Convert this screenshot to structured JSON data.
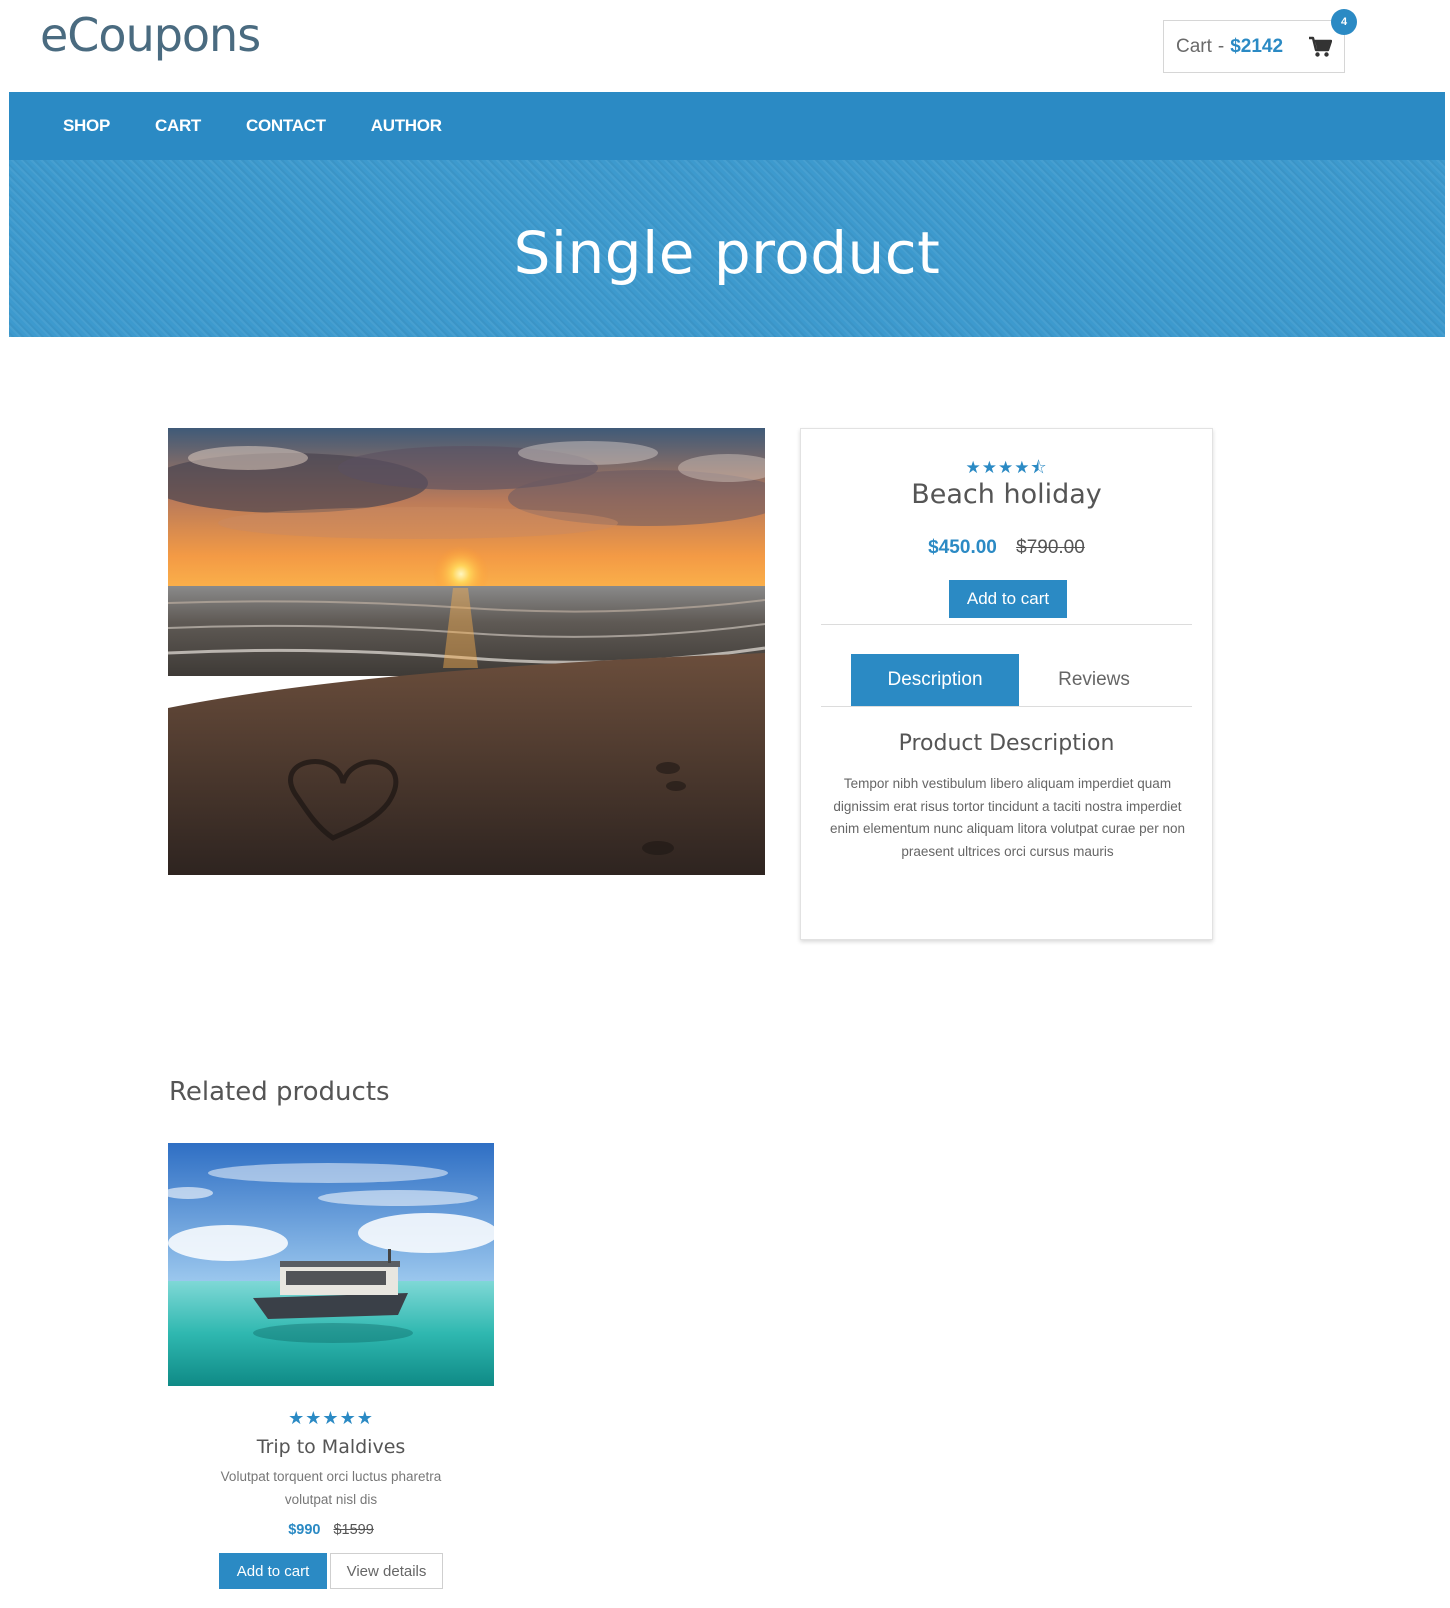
{
  "header": {
    "logo": "eCoupons",
    "cart_label": "Cart",
    "cart_separator": "-",
    "cart_amount": "$2142",
    "cart_count": "4"
  },
  "nav": {
    "items": [
      {
        "label": "SHOP"
      },
      {
        "label": "CART"
      },
      {
        "label": "CONTACT"
      },
      {
        "label": "AUTHOR"
      }
    ]
  },
  "hero": {
    "title": "Single product"
  },
  "product": {
    "rating": 4.5,
    "rating_stars": "★★★★⯪",
    "name": "Beach holiday",
    "price": "$450.00",
    "old_price": "$790.00",
    "add_to_cart_label": "Add to cart",
    "tabs": [
      {
        "label": "Description",
        "active": true
      },
      {
        "label": "Reviews",
        "active": false
      }
    ],
    "description_title": "Product Description",
    "description_text": "Tempor nibh vestibulum libero aliquam imperdiet quam dignissim erat risus tortor tincidunt a taciti nostra imperdiet enim elementum nunc aliquam litora volutpat curae per non praesent ultrices orci cursus mauris"
  },
  "related": {
    "title": "Related products",
    "items": [
      {
        "rating": 5,
        "rating_stars": "★★★★★",
        "name": "Trip to Maldives",
        "description": "Volutpat torquent orci luctus pharetra volutpat nisl dis",
        "price": "$990",
        "old_price": "$1599",
        "add_to_cart_label": "Add to cart",
        "view_details_label": "View details"
      }
    ]
  },
  "colors": {
    "accent": "#2b8ac4",
    "hero": "#3d9ace"
  }
}
